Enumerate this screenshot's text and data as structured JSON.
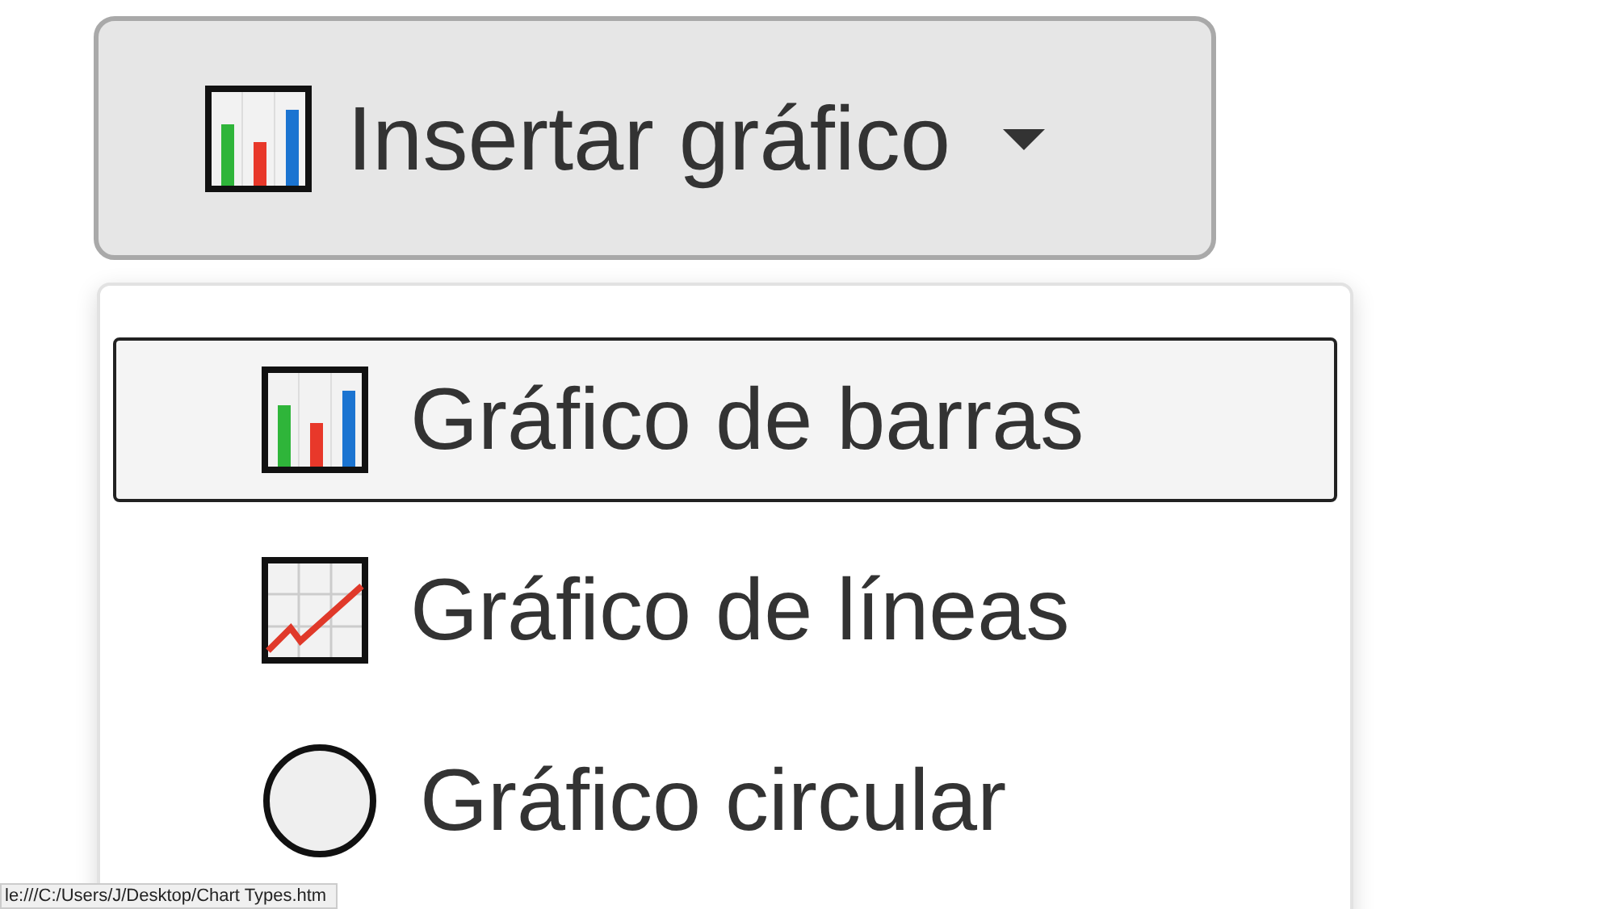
{
  "button": {
    "label": "Insertar gráfico"
  },
  "menu": {
    "items": [
      {
        "label": "Gráfico de barras",
        "kind": "bar",
        "selected": true
      },
      {
        "label": "Gráfico de líneas",
        "kind": "line",
        "selected": false
      },
      {
        "label": "Gráfico circular",
        "kind": "pie",
        "selected": false
      }
    ]
  },
  "status_bar": {
    "text": "le:///C:/Users/J/Desktop/Chart Types.htm"
  }
}
